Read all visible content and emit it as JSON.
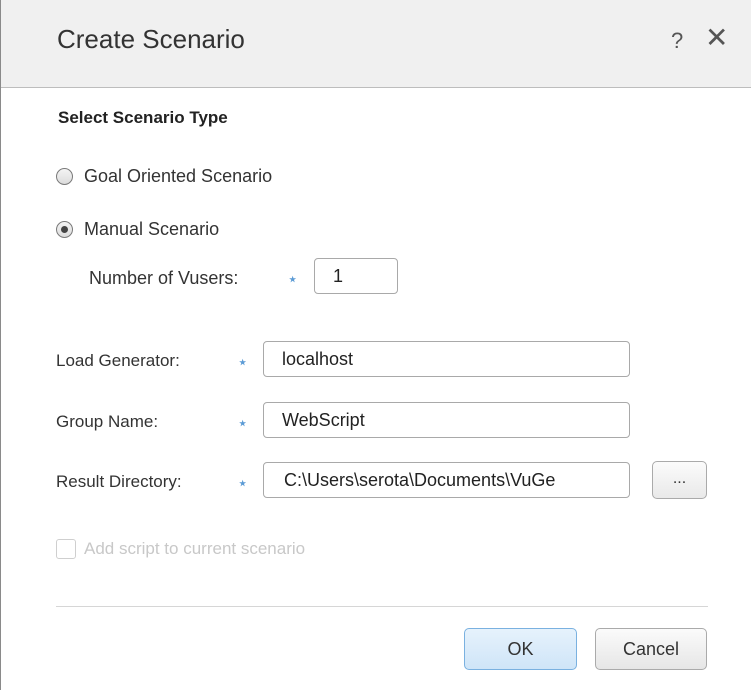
{
  "dialog": {
    "title": "Create Scenario",
    "help_label": "?",
    "close_label": "✕"
  },
  "scenario_type": {
    "heading": "Select Scenario Type",
    "options": [
      {
        "label": "Goal Oriented Scenario",
        "selected": false
      },
      {
        "label": "Manual Scenario",
        "selected": true
      }
    ]
  },
  "vusers": {
    "label": "Number of Vusers:",
    "value": "1"
  },
  "fields": {
    "required_mark": "⋆",
    "load_generator": {
      "label": "Load Generator:",
      "value": "localhost"
    },
    "group_name": {
      "label": "Group Name:",
      "value": "WebScript"
    },
    "result_directory": {
      "label": "Result Directory:",
      "value": "C:\\Users\\serota\\Documents\\VuGe"
    },
    "browse_label": "..."
  },
  "add_script": {
    "label": "Add script to current scenario",
    "checked": false,
    "enabled": false
  },
  "buttons": {
    "ok_label": "OK",
    "cancel_label": "Cancel"
  },
  "colors": {
    "required_star": "#5b9bd5",
    "ok_border": "#7ab1e0",
    "disabled_text": "#c8c8c8"
  }
}
